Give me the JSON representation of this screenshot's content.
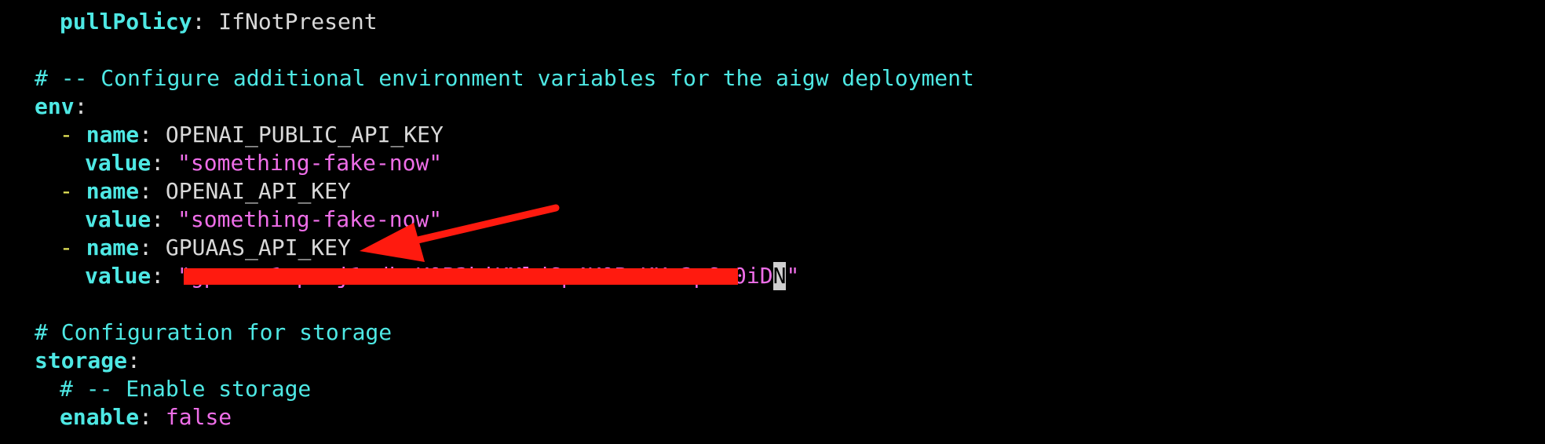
{
  "editor": {
    "lines": {
      "pull_policy": {
        "key": "pullPolicy",
        "value": "IfNotPresent"
      },
      "env_comment": "# -- Configure additional environment variables for the aigw deployment",
      "env_key": "env",
      "env_entries": [
        {
          "name_key": "name",
          "name_value": "OPENAI_PUBLIC_API_KEY",
          "value_key": "value",
          "value_value": "\"something-fake-now\""
        },
        {
          "name_key": "name",
          "name_value": "OPENAI_API_KEY",
          "value_key": "value",
          "value_value": "\"something-fake-now\""
        },
        {
          "name_key": "name",
          "name_value": "GPUAAS_API_KEY",
          "value_key": "value",
          "value_redacted_prefix": "\"",
          "value_redacted_body": "gpuaas1-proj1-dbcK0P3hiKMldCp4K0P-KKs2p6u0iD",
          "value_cursor_char": "N",
          "value_suffix": "\""
        }
      ],
      "storage_comment": "# Configuration for storage",
      "storage_key": "storage",
      "storage_enable_comment": "# -- Enable storage",
      "enable_key": "enable",
      "enable_value": "false"
    },
    "colors": {
      "background": "#000000",
      "key": "#4ee8e4",
      "string": "#ee6ee8",
      "dash": "#e8e85a",
      "plain": "#d9d9d9",
      "annotation_red": "#ff1a0f"
    },
    "annotations": {
      "arrow": "red-arrow-icon",
      "strike": "red-redaction-strike"
    }
  }
}
